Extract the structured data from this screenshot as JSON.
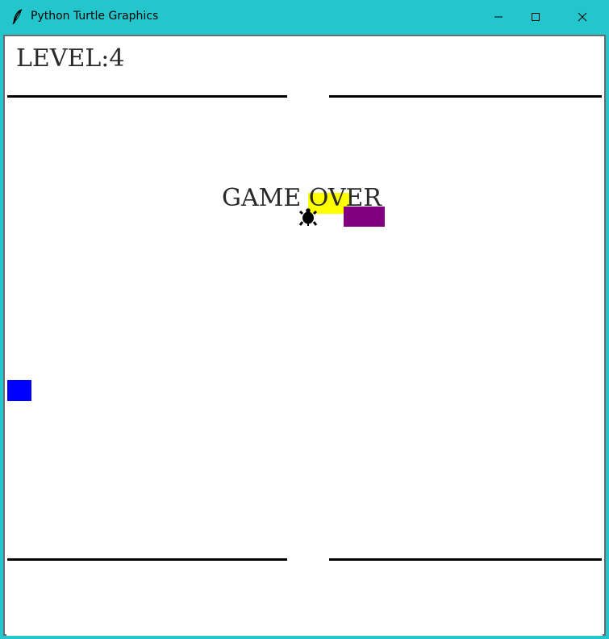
{
  "window": {
    "title": "Python Turtle Graphics",
    "background_color": "#23c6cc",
    "controls": {
      "minimize_icon": "minimize-icon",
      "maximize_icon": "maximize-icon",
      "close_icon": "close-icon"
    }
  },
  "app_icon": "feather-icon",
  "game": {
    "level_label": "LEVEL:",
    "level_value": "4",
    "game_over_text": "GAME OVER",
    "player_icon": "turtle-icon",
    "cars": [
      {
        "name": "yellow-car",
        "color": "#ffff00"
      },
      {
        "name": "purple-car",
        "color": "#800080"
      },
      {
        "name": "blue-car",
        "color": "#0000ff"
      }
    ],
    "wall_color": "#000000"
  }
}
